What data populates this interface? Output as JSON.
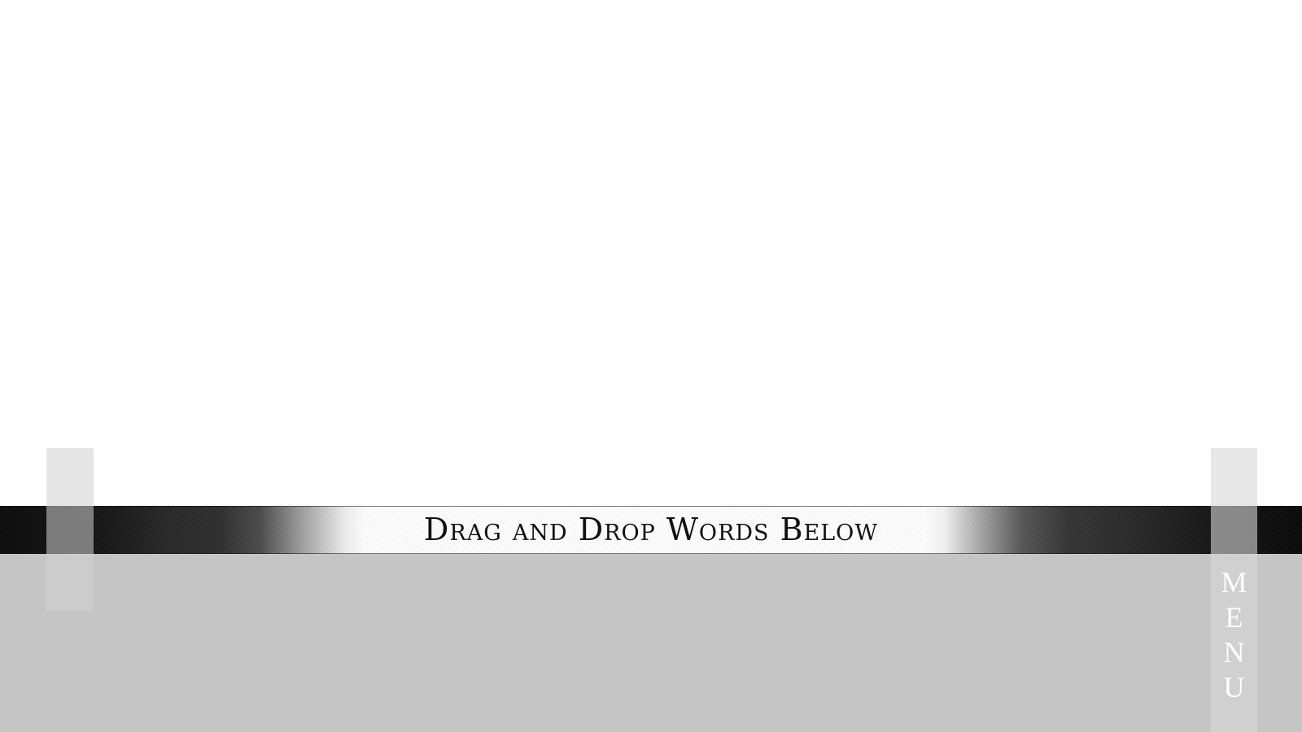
{
  "workspace": {
    "drop_area_name": "",
    "word_tray_name": ""
  },
  "banner": {
    "label": "Drag and Drop Words Below"
  },
  "menu": {
    "letters": [
      "M",
      "E",
      "N",
      "U"
    ]
  },
  "colors": {
    "background": "#ffffff",
    "tray": "#c5c5c5",
    "banner_dark": "#090909",
    "banner_light": "#ffffff",
    "side_panel": "#d7d7d7"
  }
}
